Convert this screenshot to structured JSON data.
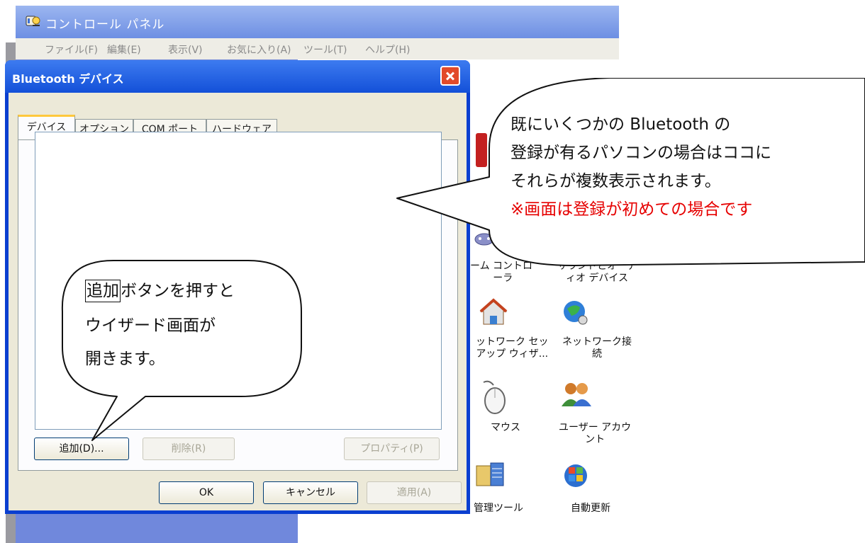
{
  "control_panel": {
    "title": "コントロール パネル",
    "menu": [
      "ファイル(F)",
      "編集(E)",
      "表示(V)",
      "お気に入り(A)",
      "ツール(T)",
      "ヘルプ(H)"
    ],
    "icons": [
      {
        "name": "game-controllers",
        "label": "ーム コントロ\n ーラ"
      },
      {
        "name": "sounds-and-audio",
        "label": "サウンドとオーデ\nィオ デバイス"
      },
      {
        "name": "network-setup",
        "label": "ットワーク セッ\nアップ ウィザ..."
      },
      {
        "name": "network-connections",
        "label": "ネットワーク接\n続"
      },
      {
        "name": "mouse",
        "label": "マウス"
      },
      {
        "name": "user-accounts",
        "label": "ユーザー アカウ\nント"
      },
      {
        "name": "admin-tools",
        "label": "管理ツール"
      },
      {
        "name": "automatic-updates",
        "label": "自動更新"
      }
    ]
  },
  "dialog": {
    "title": "Bluetooth デバイス",
    "tabs": [
      "デバイス",
      "オプション",
      "COM ポート",
      "ハードウェア"
    ],
    "buttons": {
      "add": "追加(D)...",
      "remove": "削除(R)",
      "properties": "プロパティ(P)",
      "ok": "OK",
      "cancel": "キャンセル",
      "apply": "適用(A)"
    }
  },
  "callouts": {
    "right": {
      "line1": "既にいくつかの Bluetooth の",
      "line2": "登録が有るパソコンの場合はココに",
      "line3": "それらが複数表示されます。",
      "line4": "※画面は登録が初めての場合です"
    },
    "left": {
      "highlight": "追加",
      "line1_rest": "ボタンを押すと",
      "line2": "ウイザード画面が",
      "line3": "開きます。"
    }
  },
  "colors": {
    "titlebar_blue": "#1350d8",
    "task_pane": "#7389d8",
    "dialog_face": "#ece9d8",
    "note_red": "#e60000"
  }
}
